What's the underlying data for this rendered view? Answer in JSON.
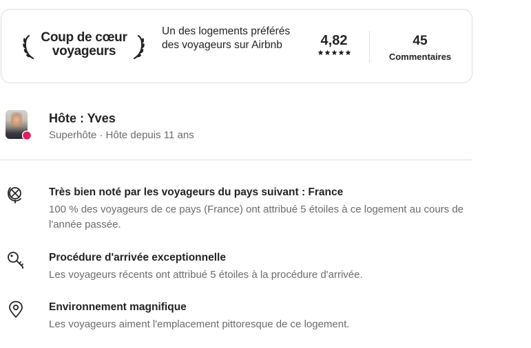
{
  "favorite": {
    "title": "Coup de cœur voyageurs",
    "description": "Un des logements préférés des voyageurs sur Airbnb"
  },
  "rating": {
    "value": "4,82",
    "stars": 5
  },
  "reviews": {
    "count": "45",
    "label": "Commentaires"
  },
  "host": {
    "name": "Hôte : Yves",
    "meta": "Superhôte · Hôte depuis 11 ans"
  },
  "highlights": [
    {
      "icon": "globe-icon",
      "title": "Très bien noté par les voyageurs du pays suivant : France",
      "description": "100 % des voyageurs de ce pays (France) ont attribué 5 étoiles à ce logement au cours de l'année passée."
    },
    {
      "icon": "key-icon",
      "title": "Procédure d'arrivée exceptionnelle",
      "description": "Les voyageurs récents ont attribué 5 étoiles à la procédure d'arrivée."
    },
    {
      "icon": "map-pin-icon",
      "title": "Environnement magnifique",
      "description": "Les voyageurs aiment l'emplacement pittoresque de ce logement."
    }
  ],
  "colors": {
    "text": "#222222",
    "muted": "#6a6a6a",
    "border": "#dddddd",
    "superhost": "#e31c5f"
  }
}
